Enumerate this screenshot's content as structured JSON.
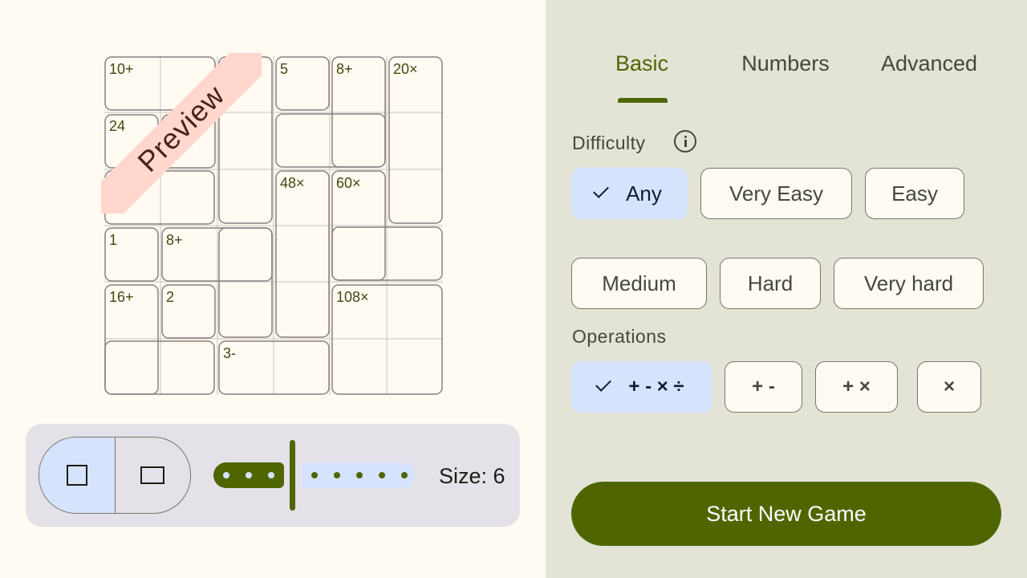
{
  "board": {
    "preview_label": "Preview",
    "cages": [
      {
        "label": "10+"
      },
      {
        "label": "24"
      },
      {
        "label": "?0×"
      },
      {
        "label": "5"
      },
      {
        "label": "8+"
      },
      {
        "label": "20×"
      },
      {
        "label": "48×"
      },
      {
        "label": "60×"
      },
      {
        "label": "1"
      },
      {
        "label": "8+"
      },
      {
        "label": "16+"
      },
      {
        "label": "2"
      },
      {
        "label": "108×"
      },
      {
        "label": "3-"
      }
    ]
  },
  "controls": {
    "shape_options": [
      "square-icon",
      "rectangle-icon"
    ],
    "selected_shape": "square",
    "size_value": 6,
    "size_label": "Size: 6"
  },
  "tabs": [
    {
      "label": "Basic",
      "active": true
    },
    {
      "label": "Numbers",
      "active": false
    },
    {
      "label": "Advanced",
      "active": false
    }
  ],
  "difficulty": {
    "label": "Difficulty",
    "options": [
      "Any",
      "Very Easy",
      "Easy",
      "Medium",
      "Hard",
      "Very hard"
    ],
    "selected": "Any"
  },
  "operations": {
    "label": "Operations",
    "options": [
      "+ - × ÷",
      "+ -",
      "+ ×",
      "×"
    ],
    "selected": "+ - × ÷"
  },
  "start_button": "Start New Game",
  "colors": {
    "accent": "#4f6600",
    "selected_chip": "#d6e3fd",
    "right_panel": "#e3e4d6",
    "ribbon": "#ffd7cc"
  }
}
